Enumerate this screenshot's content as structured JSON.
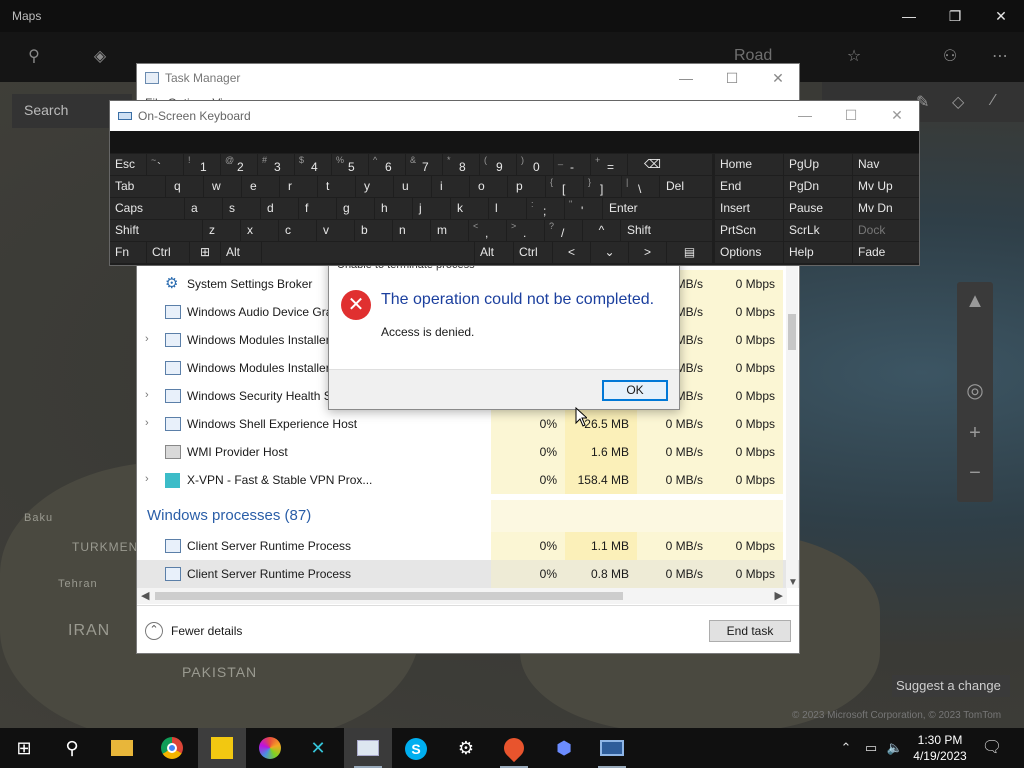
{
  "maps": {
    "title": "Maps",
    "search_placeholder": "Search",
    "road_label": "Road",
    "labels": {
      "baku": "Baku",
      "turkmeni": "TURKMENI",
      "tehran": "Tehran",
      "iran": "IRAN",
      "pakistan": "PAKISTAN"
    },
    "suggest_change": "Suggest a change",
    "copyright": "© 2023 Microsoft Corporation, © 2023 TomTom",
    "window_controls": {
      "minimize": "—",
      "maximize": "❐",
      "close": "✕"
    }
  },
  "task_manager": {
    "title": "Task Manager",
    "menu_partial": "File  Options  View",
    "window_controls": {
      "minimize": "—",
      "maximize": "☐",
      "close": "✕"
    },
    "rows": [
      {
        "name": "System Settings Broker",
        "expand": "",
        "cpu": "",
        "memory": "",
        "disk": "MB/s",
        "network": "0 Mbps"
      },
      {
        "name": "Windows Audio Device Gra",
        "expand": "",
        "cpu": "",
        "memory": "",
        "disk": "MB/s",
        "network": "0 Mbps"
      },
      {
        "name": "Windows Modules Installer",
        "expand": "›",
        "cpu": "",
        "memory": "",
        "disk": "MB/s",
        "network": "0 Mbps"
      },
      {
        "name": "Windows Modules Installer",
        "expand": "",
        "cpu": "",
        "memory": "",
        "disk": "MB/s",
        "network": "0 Mbps"
      },
      {
        "name": "Windows Security Health S",
        "expand": "›",
        "cpu": "",
        "memory": "",
        "disk": "MB/s",
        "network": "0 Mbps"
      },
      {
        "name": "Windows Shell Experience Host",
        "expand": "›",
        "cpu": "0%",
        "memory": "26.5 MB",
        "disk": "0 MB/s",
        "network": "0 Mbps"
      },
      {
        "name": "WMI Provider Host",
        "expand": "",
        "cpu": "0%",
        "memory": "1.6 MB",
        "disk": "0 MB/s",
        "network": "0 Mbps"
      },
      {
        "name": "X-VPN - Fast & Stable VPN Prox...",
        "expand": "›",
        "cpu": "0%",
        "memory": "158.4 MB",
        "disk": "0 MB/s",
        "network": "0 Mbps"
      }
    ],
    "group_header": "Windows processes (87)",
    "win_rows": [
      {
        "name": "Client Server Runtime Process",
        "cpu": "0%",
        "memory": "1.1 MB",
        "disk": "0 MB/s",
        "network": "0 Mbps"
      },
      {
        "name": "Client Server Runtime Process",
        "cpu": "0%",
        "memory": "0.8 MB",
        "disk": "0 MB/s",
        "network": "0 Mbps"
      }
    ],
    "fewer_details": "Fewer details",
    "end_task": "End task"
  },
  "dialog": {
    "clipped_title": "Unable to terminate process",
    "heading": "The operation could not be completed.",
    "message": "Access is denied.",
    "ok": "OK"
  },
  "osk": {
    "title": "On-Screen Keyboard",
    "window_controls": {
      "minimize": "—",
      "maximize": "☐",
      "close": "✕"
    },
    "keys": {
      "esc": "Esc",
      "tilde_s": "~",
      "tilde_m": "`",
      "k1s": "!",
      "k1": "1",
      "k2s": "@",
      "k2": "2",
      "k3s": "#",
      "k3": "3",
      "k4s": "$",
      "k4": "4",
      "k5s": "%",
      "k5": "5",
      "k6s": "^",
      "k6": "6",
      "k7s": "&",
      "k7": "7",
      "k8s": "*",
      "k8": "8",
      "k9s": "(",
      "k9": "9",
      "k0s": ")",
      "k0": "0",
      "minus_s": "_",
      "minus": "-",
      "eq_s": "+",
      "eq": "=",
      "bksp": "⌫",
      "home": "Home",
      "pgup": "PgUp",
      "nav": "Nav",
      "tab": "Tab",
      "q": "q",
      "w": "w",
      "e": "e",
      "r": "r",
      "t": "t",
      "y": "y",
      "u": "u",
      "i": "i",
      "o": "o",
      "p": "p",
      "lbr_s": "{",
      "lbr": "[",
      "rbr_s": "}",
      "rbr": "]",
      "bsl_s": "|",
      "bsl": "\\",
      "del": "Del",
      "end": "End",
      "pgdn": "PgDn",
      "mvup": "Mv Up",
      "caps": "Caps",
      "a": "a",
      "s": "s",
      "d": "d",
      "f": "f",
      "g": "g",
      "h": "h",
      "j": "j",
      "k": "k",
      "l": "l",
      "semi_s": ":",
      "semi": ";",
      "quote_s": "\"",
      "quote": "'",
      "enter": "Enter",
      "insert": "Insert",
      "pause": "Pause",
      "mvdn": "Mv Dn",
      "shift": "Shift",
      "z": "z",
      "x": "x",
      "c": "c",
      "v": "v",
      "b": "b",
      "n": "n",
      "m": "m",
      "comma_s": "<",
      "comma": ",",
      "dot_s": ">",
      "dot": ".",
      "slash_s": "?",
      "slash": "/",
      "up": "^",
      "shift_r": "Shift",
      "prtscn": "PrtScn",
      "scrlk": "ScrLk",
      "dock": "Dock",
      "fn": "Fn",
      "ctrl": "Ctrl",
      "win": "⊞",
      "alt": "Alt",
      "alt_r": "Alt",
      "ctrl_r": "Ctrl",
      "left": "<",
      "down": "⌄",
      "right": ">",
      "menu": "▤",
      "options": "Options",
      "help": "Help",
      "fade": "Fade"
    }
  },
  "taskbar": {
    "start": "⊞",
    "search": "⚲",
    "apps": [
      "File Explorer",
      "Chrome",
      "Sticky Notes",
      "Photos",
      "X-VPN",
      "Task Manager",
      "Skype",
      "Settings",
      "Maps",
      "Copilot",
      "Remote Desktop"
    ],
    "tray": {
      "chevron": "⌃",
      "network": "▭",
      "volume": "🔈"
    },
    "time": "1:30 PM",
    "date": "4/19/2023"
  }
}
